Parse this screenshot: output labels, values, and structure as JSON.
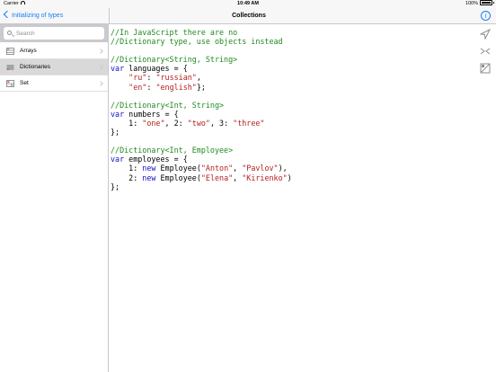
{
  "status_bar": {
    "carrier": "Carrier",
    "time": "10:49 AM",
    "battery": "100%"
  },
  "master_nav": {
    "back_label": "Initializing of types"
  },
  "detail_nav": {
    "title": "Collections"
  },
  "search": {
    "placeholder": "Search"
  },
  "sidebar": {
    "items": [
      {
        "label": "Arrays",
        "icon": "array-icon",
        "selected": false
      },
      {
        "label": "Dictionaries",
        "icon": "dictionary-icon",
        "selected": true
      },
      {
        "label": "Set",
        "icon": "set-icon",
        "selected": false
      }
    ]
  },
  "code": {
    "lines": [
      [
        {
          "t": "//In JavaScript there are no",
          "c": "cm"
        }
      ],
      [
        {
          "t": "//Dictionary type, use objects instead",
          "c": "cm"
        }
      ],
      [],
      [
        {
          "t": "//Dictionary<String, String>",
          "c": "cm"
        }
      ],
      [
        {
          "t": "var",
          "c": "kw"
        },
        {
          "t": " languages = {",
          "c": "pl"
        }
      ],
      [
        {
          "t": "    ",
          "c": "pl"
        },
        {
          "t": "\"ru\"",
          "c": "str"
        },
        {
          "t": ": ",
          "c": "pl"
        },
        {
          "t": "\"russian\"",
          "c": "str"
        },
        {
          "t": ",",
          "c": "pl"
        }
      ],
      [
        {
          "t": "    ",
          "c": "pl"
        },
        {
          "t": "\"en\"",
          "c": "str"
        },
        {
          "t": ": ",
          "c": "pl"
        },
        {
          "t": "\"english\"",
          "c": "str"
        },
        {
          "t": "};",
          "c": "pl"
        }
      ],
      [],
      [
        {
          "t": "//Dictionary<Int, String>",
          "c": "cm"
        }
      ],
      [
        {
          "t": "var",
          "c": "kw"
        },
        {
          "t": " numbers = {",
          "c": "pl"
        }
      ],
      [
        {
          "t": "    1: ",
          "c": "pl"
        },
        {
          "t": "\"one\"",
          "c": "str"
        },
        {
          "t": ", 2: ",
          "c": "pl"
        },
        {
          "t": "\"two\"",
          "c": "str"
        },
        {
          "t": ", 3: ",
          "c": "pl"
        },
        {
          "t": "\"three\"",
          "c": "str"
        }
      ],
      [
        {
          "t": "};",
          "c": "pl"
        }
      ],
      [],
      [
        {
          "t": "//Dictionary<Int, Employee>",
          "c": "cm"
        }
      ],
      [
        {
          "t": "var",
          "c": "kw"
        },
        {
          "t": " employees = {",
          "c": "pl"
        }
      ],
      [
        {
          "t": "    1: ",
          "c": "pl"
        },
        {
          "t": "new",
          "c": "kw"
        },
        {
          "t": " Employee(",
          "c": "pl"
        },
        {
          "t": "\"Anton\"",
          "c": "str"
        },
        {
          "t": ", ",
          "c": "pl"
        },
        {
          "t": "\"Pavlov\"",
          "c": "str"
        },
        {
          "t": "),",
          "c": "pl"
        }
      ],
      [
        {
          "t": "    2: ",
          "c": "pl"
        },
        {
          "t": "new",
          "c": "kw"
        },
        {
          "t": " Employee(",
          "c": "pl"
        },
        {
          "t": "\"Elena\"",
          "c": "str"
        },
        {
          "t": ", ",
          "c": "pl"
        },
        {
          "t": "\"Kirienko\"",
          "c": "str"
        },
        {
          "t": ")",
          "c": "pl"
        }
      ],
      [
        {
          "t": "};",
          "c": "pl"
        }
      ]
    ]
  },
  "toolbar": {
    "tools": [
      "send-icon",
      "compare-icon",
      "switch-language-icon"
    ]
  },
  "colors": {
    "accent": "#1c7cf4",
    "comment": "#1f8a1f",
    "keyword": "#0b12c8",
    "string": "#b5201f"
  }
}
